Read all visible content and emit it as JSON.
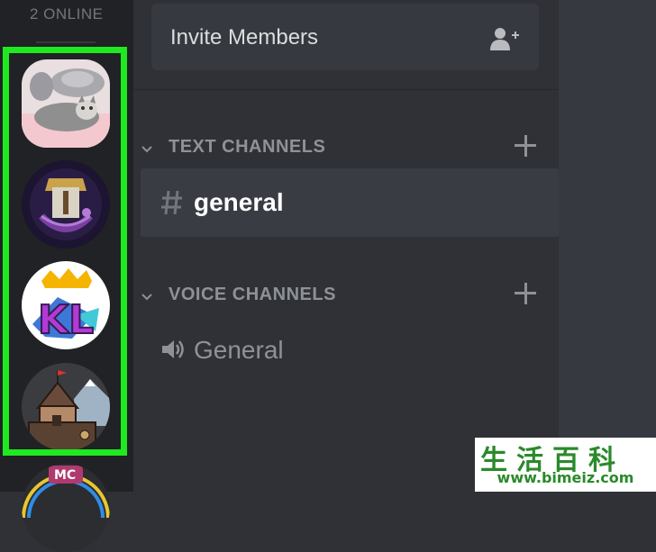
{
  "online": {
    "label": "2 ONLINE"
  },
  "servers": [
    {
      "name": "cat-pillow-server",
      "icon": "cat-avatar"
    },
    {
      "name": "castle-crest-server",
      "icon": "crest-avatar"
    },
    {
      "name": "kl-server",
      "icon": "kl-logo",
      "text": "KL"
    },
    {
      "name": "castle-server",
      "icon": "castle-avatar"
    },
    {
      "name": "mc-server",
      "icon": "mc-logo",
      "text": "MC"
    }
  ],
  "invite": {
    "label": "Invite Members",
    "icon": "add-user-icon"
  },
  "categories": {
    "text": {
      "label": "TEXT CHANNELS"
    },
    "voice": {
      "label": "VOICE CHANNELS"
    }
  },
  "channels": {
    "text": [
      {
        "name": "general",
        "icon": "hash-icon",
        "active": true
      }
    ],
    "voice": [
      {
        "name": "General",
        "icon": "speaker-icon"
      }
    ]
  },
  "watermark": {
    "chinese": "生活百科",
    "url": "www.bimeiz.com"
  },
  "colors": {
    "highlight": "#1fe91f",
    "rail": "#202225",
    "sidebar": "#2f3136",
    "main": "#36393f",
    "watermark": "#2a8a2a"
  }
}
